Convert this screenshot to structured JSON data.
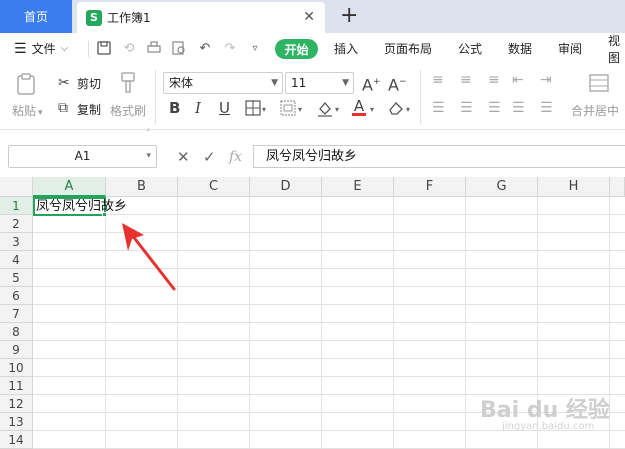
{
  "tabs": {
    "home": "首页",
    "document": "工作簿1",
    "document_icon": "S"
  },
  "menu": {
    "file": "文件",
    "items": [
      "开始",
      "插入",
      "页面布局",
      "公式",
      "数据",
      "审阅",
      "视图"
    ]
  },
  "ribbon": {
    "paste": "粘贴",
    "cut": "剪切",
    "copy": "复制",
    "format_painter": "格式刷",
    "font_name": "宋体",
    "font_size": "11",
    "bold": "B",
    "italic": "I",
    "underline": "U",
    "font_color_letter": "A",
    "merge_center": "合并居中"
  },
  "formula_bar": {
    "name_box": "A1",
    "fx": "fx",
    "value": "凤兮凤兮归故乡"
  },
  "grid": {
    "columns": [
      "A",
      "B",
      "C",
      "D",
      "E",
      "F",
      "G",
      "H"
    ],
    "rows": [
      "1",
      "2",
      "3",
      "4",
      "5",
      "6",
      "7",
      "8",
      "9",
      "10",
      "11",
      "12",
      "13",
      "14"
    ],
    "cell_a1": "凤兮凤兮归故乡"
  },
  "watermark": {
    "text": "Bai du 经验",
    "sub": "jingyan.baidu.com"
  },
  "colors": {
    "accent_green": "#22a559",
    "home_tab_blue": "#3b7df0",
    "arrow_red": "#e8322f"
  }
}
